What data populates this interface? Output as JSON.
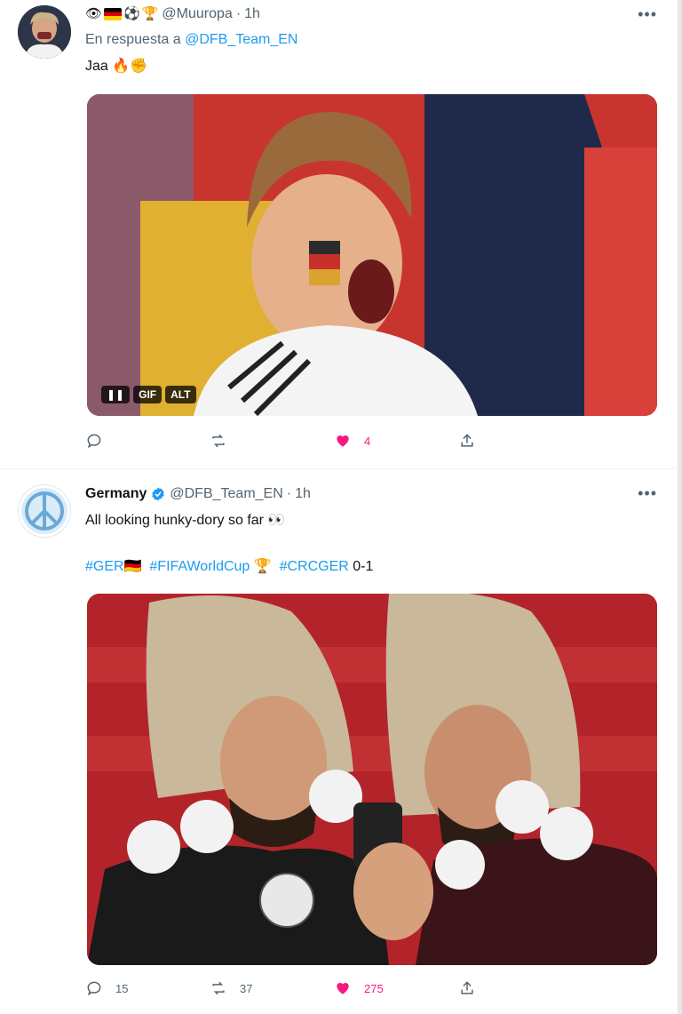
{
  "tweets": [
    {
      "author_emojis": [
        "👁",
        "🇩🇪",
        "⚽",
        "🏆"
      ],
      "handle": "@Muuropa",
      "separator": "·",
      "time": "1h",
      "reply_prefix": "En respuesta a",
      "reply_handle": "@DFB_Team_EN",
      "text": "Jaa 🔥✊",
      "media_badges": [
        "❚❚",
        "GIF",
        "ALT"
      ],
      "counts": {
        "reply": "",
        "retweet": "",
        "like": "4"
      }
    },
    {
      "name": "Germany",
      "handle": "@DFB_Team_EN",
      "separator": "·",
      "time": "1h",
      "text": "All looking hunky-dory so far 👀",
      "hashtags": [
        "#GER🇩🇪",
        "#FIFAWorldCup 🏆",
        "#CRCGER"
      ],
      "score": "0-1",
      "counts": {
        "reply": "15",
        "retweet": "37",
        "like": "275"
      }
    }
  ],
  "icons": {
    "more": "more-icon",
    "reply": "reply-icon",
    "retweet": "retweet-icon",
    "like": "heart-icon",
    "share": "share-icon",
    "verified": "verified-badge-icon"
  },
  "colors": {
    "accent": "#1d9bf0",
    "like": "#f91880",
    "muted": "#536471"
  }
}
